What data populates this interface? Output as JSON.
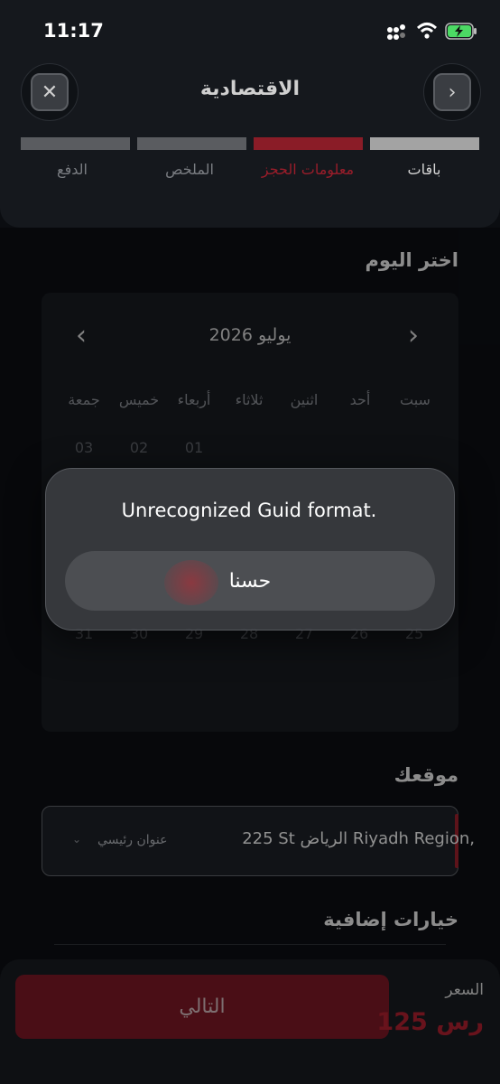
{
  "status_bar": {
    "time": "11:17"
  },
  "header": {
    "title": "الاقتصادية",
    "close_icon": "close-icon",
    "forward_icon": "chevron-right-icon",
    "steps": [
      {
        "label": "باقات",
        "state": "completed"
      },
      {
        "label": "معلومات الحجز",
        "state": "active"
      },
      {
        "label": "الملخص",
        "state": "pending"
      },
      {
        "label": "الدفع",
        "state": "pending"
      }
    ]
  },
  "calendar": {
    "section_title": "اختر اليوم",
    "month_label": "يوليو 2026",
    "weekdays": [
      "سبت",
      "أحد",
      "اثنين",
      "ثلاثاء",
      "أربعاء",
      "خميس",
      "جمعة"
    ],
    "first_week": [
      "01",
      "02",
      "03"
    ],
    "last_week": [
      "31",
      "30",
      "29",
      "28",
      "27",
      "26",
      "25"
    ]
  },
  "alert": {
    "message": "Unrecognized Guid format.",
    "ok_label": "حسنا"
  },
  "location": {
    "section_title": "موقعك",
    "address": "225 St الرياض Riyadh Region,",
    "address_type": "عنوان رئيسي"
  },
  "extras": {
    "section_title": "خيارات إضافية"
  },
  "footer": {
    "next_label": "التالي",
    "price_label": "السعر",
    "price_value": "125 رس"
  },
  "colors": {
    "accent": "#8a1c27",
    "step_active": "#8a1c27",
    "step_completed": "#a3a3a3",
    "step_pending": "#5a5c60"
  }
}
